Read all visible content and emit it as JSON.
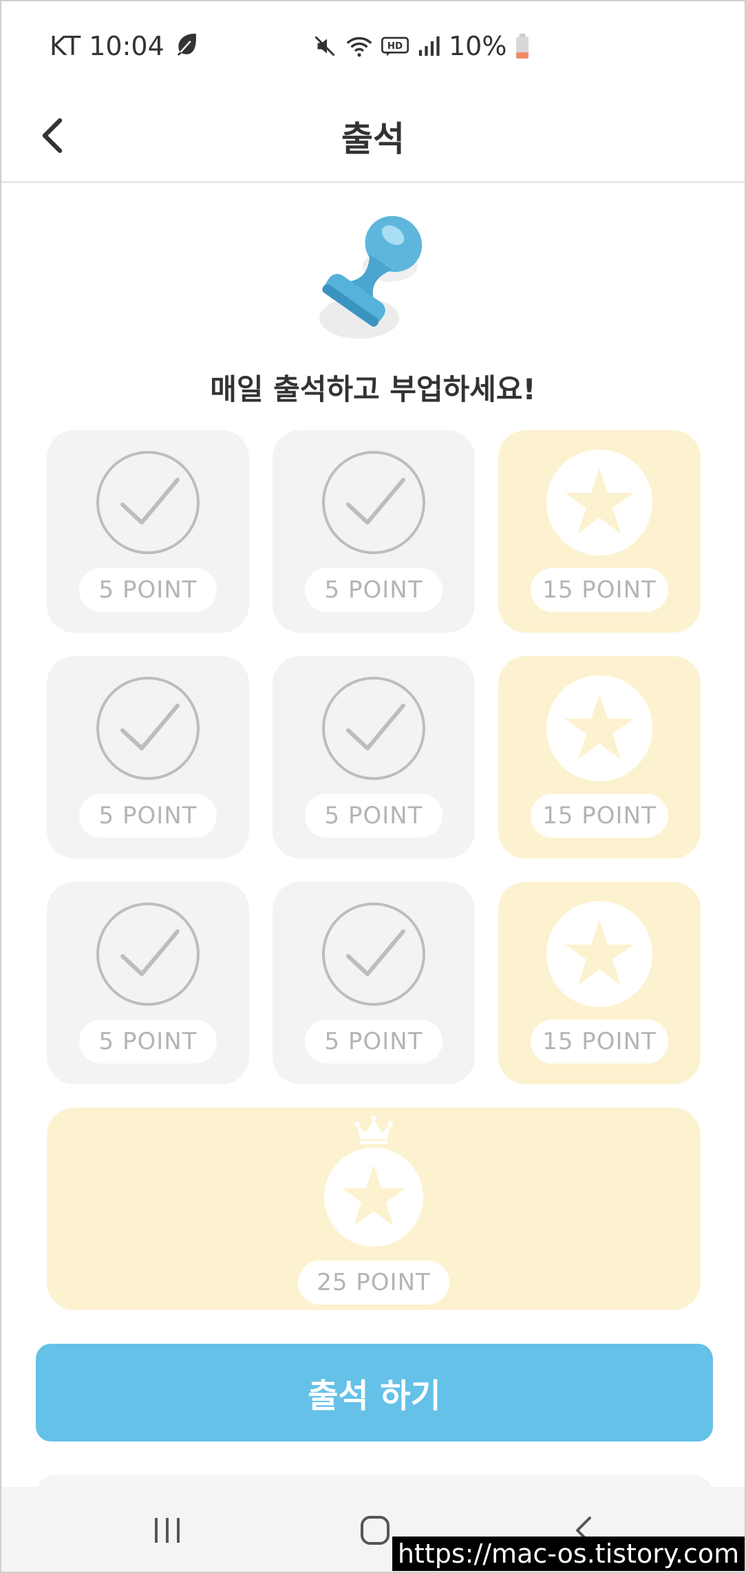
{
  "status_bar": {
    "carrier_time": "KT 10:04",
    "battery_percent": "10%",
    "icons": [
      "leaf-icon",
      "mute-icon",
      "wifi-icon",
      "hd-voice-icon",
      "signal-icon",
      "battery-low-icon"
    ]
  },
  "app_bar": {
    "title": "출석",
    "back_icon": "chevron-left-icon"
  },
  "stamp_icon": "stamp-icon",
  "headline": "매일 출석하고 부업하세요!",
  "days": [
    {
      "label": "5 POINT",
      "state": "checked",
      "icon": "check-circle-icon"
    },
    {
      "label": "5 POINT",
      "state": "checked",
      "icon": "check-circle-icon"
    },
    {
      "label": "15 POINT",
      "state": "bonus",
      "icon": "star-icon"
    },
    {
      "label": "5 POINT",
      "state": "checked",
      "icon": "check-circle-icon"
    },
    {
      "label": "5 POINT",
      "state": "checked",
      "icon": "check-circle-icon"
    },
    {
      "label": "15 POINT",
      "state": "bonus",
      "icon": "star-icon"
    },
    {
      "label": "5 POINT",
      "state": "checked",
      "icon": "check-circle-icon"
    },
    {
      "label": "5 POINT",
      "state": "checked",
      "icon": "check-circle-icon"
    },
    {
      "label": "15 POINT",
      "state": "bonus",
      "icon": "star-icon"
    }
  ],
  "final_reward": {
    "label": "25 POINT",
    "icon": "star-icon",
    "badge_icon": "crown-icon"
  },
  "attend_button": "출석 하기",
  "colors": {
    "primary": "#65c1e8",
    "card_gray": "#f3f3f3",
    "card_yellow": "#fdf2cf",
    "check_gray": "#bdbdbd",
    "text_dark": "#333333"
  },
  "nav_bar": {
    "icons": [
      "recent-apps-icon",
      "home-icon",
      "back-icon"
    ]
  },
  "watermark": "https://mac-os.tistory.com"
}
